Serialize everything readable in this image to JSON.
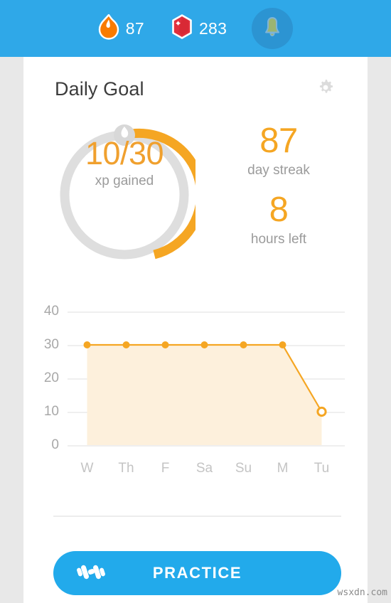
{
  "topbar": {
    "streak": {
      "icon": "flame-icon",
      "value": "87"
    },
    "gems": {
      "icon": "gem-icon",
      "value": "283"
    },
    "notifications": {
      "icon": "bell-icon"
    },
    "bg_color": "#2fa8e8"
  },
  "card": {
    "title": "Daily Goal",
    "settings_icon": "gear-icon"
  },
  "goal": {
    "progress_text": "10/30",
    "progress_label": "xp gained",
    "current_xp": 10,
    "target_xp": 30,
    "percent": 33,
    "ring_track_color": "#dedede",
    "ring_fill_color": "#f5a623",
    "badge_icon": "flame-badge-icon"
  },
  "stats": [
    {
      "value": "87",
      "label": "day streak"
    },
    {
      "value": "8",
      "label": "hours left"
    }
  ],
  "chart_data": {
    "type": "area",
    "title": "",
    "xlabel": "",
    "ylabel": "",
    "categories": [
      "W",
      "Th",
      "F",
      "Sa",
      "Su",
      "M",
      "Tu"
    ],
    "values": [
      30,
      30,
      30,
      30,
      30,
      30,
      10
    ],
    "yticks": [
      "0",
      "10",
      "20",
      "30",
      "40"
    ],
    "ytick_values": [
      0,
      10,
      20,
      30,
      40
    ],
    "ylim": [
      0,
      40
    ],
    "grid": true,
    "legend": "none",
    "line_color": "#f5a623",
    "fill_color": "#fdf0dc",
    "marker_style": [
      "filled",
      "filled",
      "filled",
      "filled",
      "filled",
      "filled",
      "hollow"
    ]
  },
  "footer": {
    "practice_label": "PRACTICE",
    "practice_icon": "dumbbell-icon",
    "button_color": "#22aaeb"
  },
  "watermark": "wsxdn.com"
}
